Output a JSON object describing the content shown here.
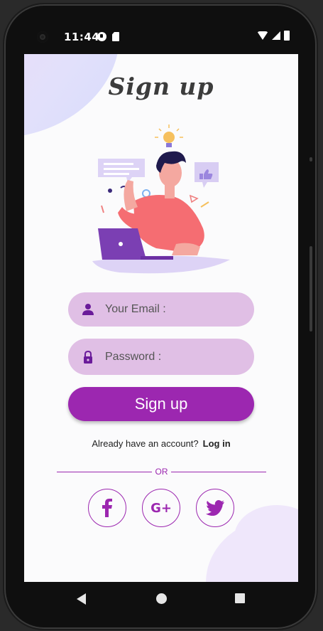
{
  "status_bar": {
    "time": "11:44"
  },
  "page": {
    "title": "Sign up",
    "email_placeholder": "Your Email :",
    "password_placeholder": "Password :",
    "signup_button": "Sign up",
    "account_prompt": "Already have an account?",
    "login_link": "Log in",
    "divider_text": "OR"
  },
  "social": [
    {
      "name": "facebook",
      "glyph": "f"
    },
    {
      "name": "google-plus",
      "glyph": "G+"
    },
    {
      "name": "twitter",
      "glyph": "twitter-bird"
    }
  ],
  "colors": {
    "accent": "#9c27b0",
    "field_bg": "#e0bfe5",
    "screen_bg": "#fbfbfc"
  }
}
